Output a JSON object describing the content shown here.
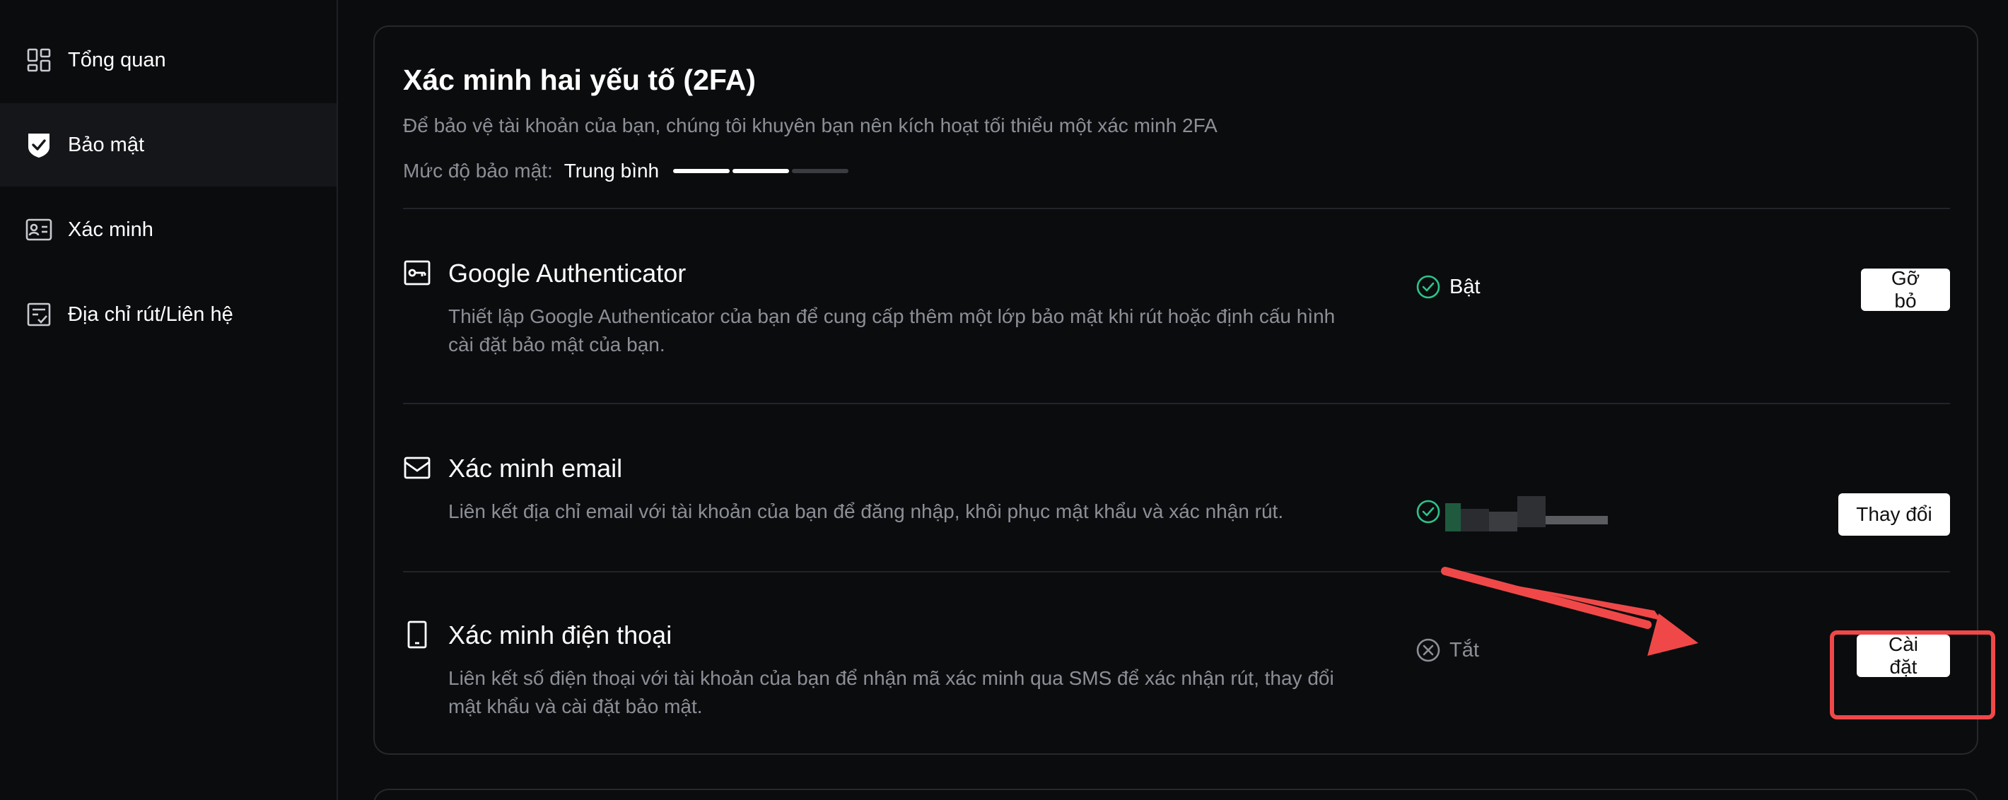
{
  "sidebar": {
    "items": [
      {
        "label": "Tổng quan",
        "icon": "dashboard-icon",
        "active": false
      },
      {
        "label": "Bảo mật",
        "icon": "shield-check-icon",
        "active": true
      },
      {
        "label": "Xác minh",
        "icon": "id-card-icon",
        "active": false
      },
      {
        "label": "Địa chỉ rút/Liên hệ",
        "icon": "address-book-icon",
        "active": false
      }
    ]
  },
  "twofa": {
    "title": "Xác minh hai yếu tố (2FA)",
    "description": "Để bảo vệ tài khoản của bạn, chúng tôi khuyên bạn nên kích hoạt tối thiểu một xác minh 2FA",
    "security_level_label": "Mức độ bảo mật",
    "security_level_value": "Trung bình",
    "security_level_segments_filled": 2,
    "security_level_segments_total": 3,
    "methods": [
      {
        "title": "Google Authenticator",
        "icon": "authenticator-key-icon",
        "description": "Thiết lập Google Authenticator của bạn để cung cấp thêm một lớp bảo mật khi rút hoặc định cấu hình cài đặt bảo mật của bạn.",
        "status": "Bật",
        "status_icon": "check-circle-icon",
        "action": "Gỡ bỏ"
      },
      {
        "title": "Xác minh email",
        "icon": "envelope-icon",
        "description": "Liên kết địa chỉ email với tài khoản của bạn để đăng nhập, khôi phục mật khẩu và xác nhận rút.",
        "status_icon": "check-circle-icon",
        "action": "Thay đổi"
      },
      {
        "title": "Xác minh điện thoại",
        "icon": "phone-icon",
        "description": "Liên kết số điện thoại với tài khoản của bạn để nhận mã xác minh qua SMS để xác nhận rút, thay đổi mật khẩu và cài đặt bảo mật.",
        "status": "Tắt",
        "status_icon": "x-circle-icon",
        "action": "Cài đặt"
      }
    ]
  },
  "colors": {
    "background": "#0b0c0e",
    "accent_green": "#2bc48a",
    "annotation_red": "#f04848"
  }
}
